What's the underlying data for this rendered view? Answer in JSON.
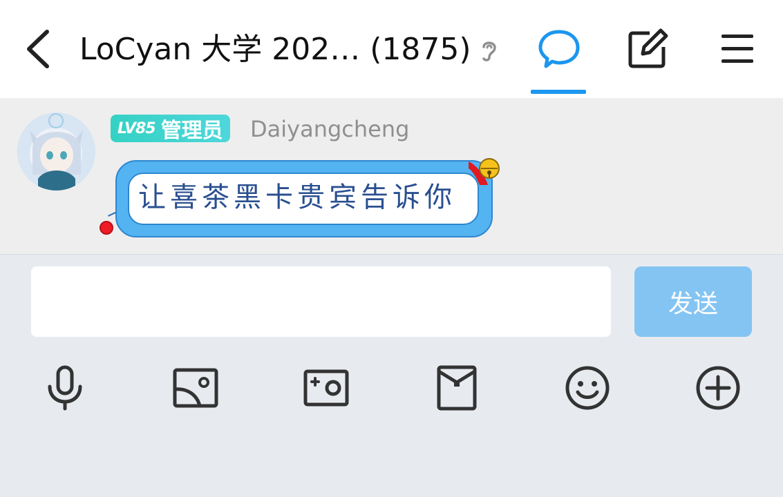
{
  "header": {
    "title": "LoCyan 大学 202… (1875)",
    "icons": [
      "back-icon",
      "ear-icon",
      "chat-tab-icon",
      "edit-icon",
      "menu-icon"
    ],
    "active_tab_color": "#1c96ee"
  },
  "message": {
    "level": "LV85",
    "role": "管理员",
    "username": "Daiyangcheng",
    "text": "让喜茶黑卡贵宾告诉你",
    "badge_color": "#34d1c4",
    "bubble_color": "#54b4f2"
  },
  "composer": {
    "input_value": "",
    "send_label": "发送",
    "send_color": "#7fc2f3"
  },
  "toolbar": {
    "icons": [
      "microphone-icon",
      "image-icon",
      "camera-icon",
      "red-packet-icon",
      "emoji-icon",
      "plus-icon"
    ]
  }
}
